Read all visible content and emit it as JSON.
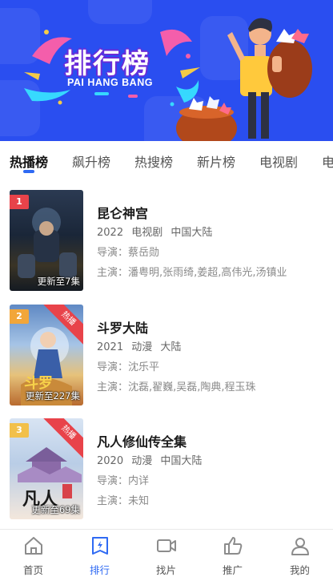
{
  "banner": {
    "title": "排行榜",
    "subtitle": "PAI HANG BANG",
    "bg_color": "#2a4ef0"
  },
  "tabs": [
    {
      "label": "热播榜",
      "active": true
    },
    {
      "label": "飙升榜",
      "active": false
    },
    {
      "label": "热搜榜",
      "active": false
    },
    {
      "label": "新片榜",
      "active": false
    },
    {
      "label": "电视剧",
      "active": false
    },
    {
      "label": "电",
      "active": false
    }
  ],
  "list": [
    {
      "rank": "1",
      "rank_color": "#e8434a",
      "hot_ribbon": "",
      "episode_info": "更新至7集",
      "title": "昆仑神宫",
      "year": "2022",
      "genre": "电视剧",
      "region": "中国大陆",
      "director": "导演：蔡岳勋",
      "cast": "主演：潘粤明,张雨绮,姜超,高伟光,汤镇业"
    },
    {
      "rank": "2",
      "rank_color": "#f2a63a",
      "hot_ribbon": "热播",
      "episode_info": "更新至227集",
      "title": "斗罗大陆",
      "year": "2021",
      "genre": "动漫",
      "region": "大陆",
      "director": "导演：沈乐平",
      "cast": "主演：沈磊,翟巍,吴磊,陶典,程玉珠"
    },
    {
      "rank": "3",
      "rank_color": "#f2c04a",
      "hot_ribbon": "热播",
      "episode_info": "更新至69集",
      "title": "凡人修仙传全集",
      "year": "2020",
      "genre": "动漫",
      "region": "中国大陆",
      "director": "导演：内详",
      "cast": "主演：未知"
    }
  ],
  "bottom_nav": [
    {
      "label": "首页",
      "icon": "home-icon",
      "active": false
    },
    {
      "label": "排行",
      "icon": "ranking-icon",
      "active": true
    },
    {
      "label": "找片",
      "icon": "video-camera-icon",
      "active": false
    },
    {
      "label": "推广",
      "icon": "thumbs-up-icon",
      "active": false
    },
    {
      "label": "我的",
      "icon": "user-icon",
      "active": false
    }
  ],
  "accent_color": "#2f6af3"
}
